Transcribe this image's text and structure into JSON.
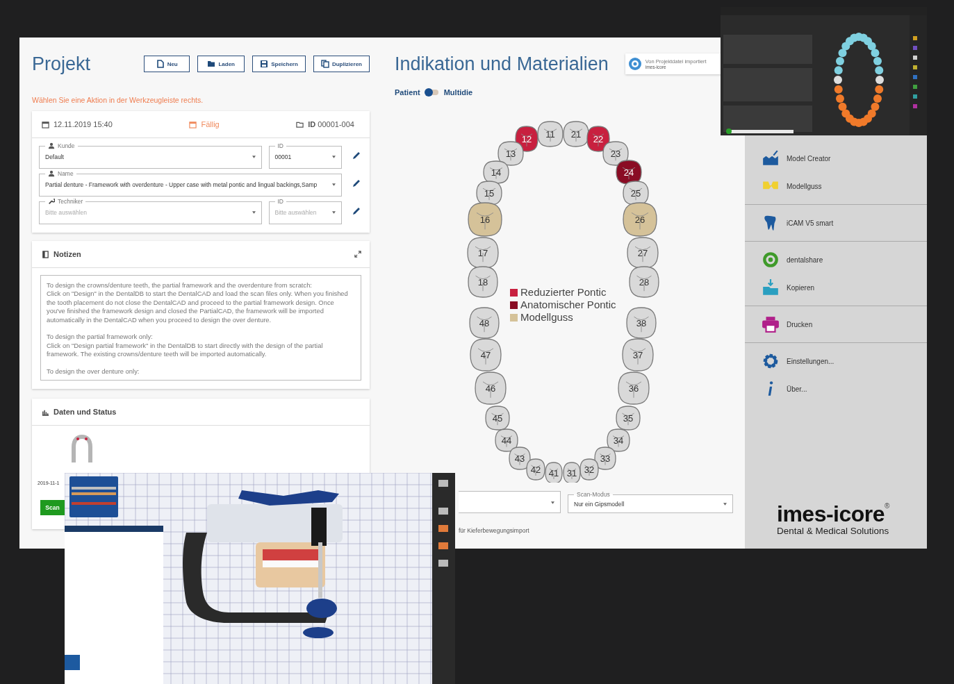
{
  "project": {
    "title": "Projekt",
    "toolbar": [
      {
        "label": "Neu"
      },
      {
        "label": "Laden"
      },
      {
        "label": "Speichern"
      },
      {
        "label": "Duplizieren"
      }
    ],
    "hint": "Wählen Sie eine Aktion in der Werkzeugleiste rechts.",
    "created": "12.11.2019 15:40",
    "due": "Fällig",
    "project_id": "**ID** 00001-004",
    "field_rows": [
      [
        {
          "label": "Kunde",
          "value": "Default"
        },
        {
          "label": "ID",
          "value": "00001"
        }
      ],
      [
        {
          "label": "Name",
          "value": "Partial denture - Framework with overdenture - Upper case with metal pontic and lingual backings,Samp"
        }
      ],
      [
        {
          "label": "Techniker",
          "placeholder": "Bitte auswählen"
        },
        {
          "label": "ID",
          "placeholder": "Bitte auswählen"
        }
      ]
    ],
    "notes": {
      "title": "Notizen",
      "text": "To design the crowns/denture teeth, the partial framework and the overdenture from scratch:\nClick on \"Design\" in the DentalDB to start the DentalCAD and load the scan files only. When you finished the tooth placement do not close the DentalCAD and proceed to the partial framework design. Once you've finished the framework design and closed the PartialCAD, the framework will be imported automatically in the DentalCAD when you proceed to design the over denture.\n\nTo design the partial framework only:\nClick on \"Design partial framework\" in the DentalDB to start directly with the design of the partial framework. The existing crowns/denture teeth will be imported automatically.\n\nTo design the over denture only:"
    },
    "status": {
      "title": "Daten und Status",
      "scan_date": "2019-11-1",
      "scan_button": "Scan"
    }
  },
  "indication": {
    "title": "Indikation und Materialien",
    "import": {
      "label": "Von Projektdatei importiert",
      "source": "imes-icore"
    },
    "toggle": {
      "left": "Patient",
      "right": "Multidie",
      "on": false
    },
    "teeth": [
      {
        "number": "11",
        "color": "#d9d9d9"
      },
      {
        "number": "21",
        "color": "#d9d9d9"
      },
      {
        "number": "12",
        "color": "#c8203f"
      },
      {
        "number": "22",
        "color": "#c8203f"
      },
      {
        "number": "13",
        "color": "#d9d9d9"
      },
      {
        "number": "23",
        "color": "#d9d9d9"
      },
      {
        "number": "14",
        "color": "#d9d9d9"
      },
      {
        "number": "24",
        "color": "#8a0c24"
      },
      {
        "number": "15",
        "color": "#d9d9d9"
      },
      {
        "number": "25",
        "color": "#d9d9d9"
      },
      {
        "number": "16",
        "color": "#d5c299"
      },
      {
        "number": "26",
        "color": "#d5c299"
      },
      {
        "number": "17",
        "color": "#d9d9d9"
      },
      {
        "number": "27",
        "color": "#d9d9d9"
      },
      {
        "number": "18",
        "color": "#d9d9d9"
      },
      {
        "number": "28",
        "color": "#d9d9d9"
      },
      {
        "number": "48",
        "color": "#d9d9d9"
      },
      {
        "number": "38",
        "color": "#d9d9d9"
      },
      {
        "number": "47",
        "color": "#d9d9d9"
      },
      {
        "number": "37",
        "color": "#d9d9d9"
      },
      {
        "number": "46",
        "color": "#d9d9d9"
      },
      {
        "number": "36",
        "color": "#d9d9d9"
      },
      {
        "number": "45",
        "color": "#d9d9d9"
      },
      {
        "number": "35",
        "color": "#d9d9d9"
      },
      {
        "number": "44",
        "color": "#d9d9d9"
      },
      {
        "number": "34",
        "color": "#d9d9d9"
      },
      {
        "number": "43",
        "color": "#d9d9d9"
      },
      {
        "number": "33",
        "color": "#d9d9d9"
      },
      {
        "number": "42",
        "color": "#d9d9d9"
      },
      {
        "number": "32",
        "color": "#d9d9d9"
      },
      {
        "number": "41",
        "color": "#d9d9d9"
      },
      {
        "number": "31",
        "color": "#d9d9d9"
      }
    ],
    "legend": [
      {
        "label": "Reduzierter Pontic",
        "color": "#c8203f"
      },
      {
        "label": "Anatomischer Pontic",
        "color": "#8a0c24"
      },
      {
        "label": "Modellguss",
        "color": "#d5c299"
      }
    ],
    "scan_mode": {
      "label": "Scan-Modus",
      "value": "Nur ein Gipsmodell"
    },
    "motion_import_note": "für Kieferbewegungsimport"
  },
  "sidebar": {
    "groups": [
      [
        {
          "label": "Model Creator"
        },
        {
          "label": "Modellguss"
        }
      ],
      [
        {
          "label": "iCAM V5 smart"
        }
      ],
      [
        {
          "label": "dentalshare"
        },
        {
          "label": "Kopieren"
        }
      ],
      [
        {
          "label": "Drucken"
        }
      ],
      [
        {
          "label": "Einstellungen..."
        },
        {
          "label": "Über..."
        }
      ]
    ],
    "logo": {
      "name": "imes-icore",
      "mark": "®",
      "tagline": "Dental & Medical Solutions"
    }
  }
}
